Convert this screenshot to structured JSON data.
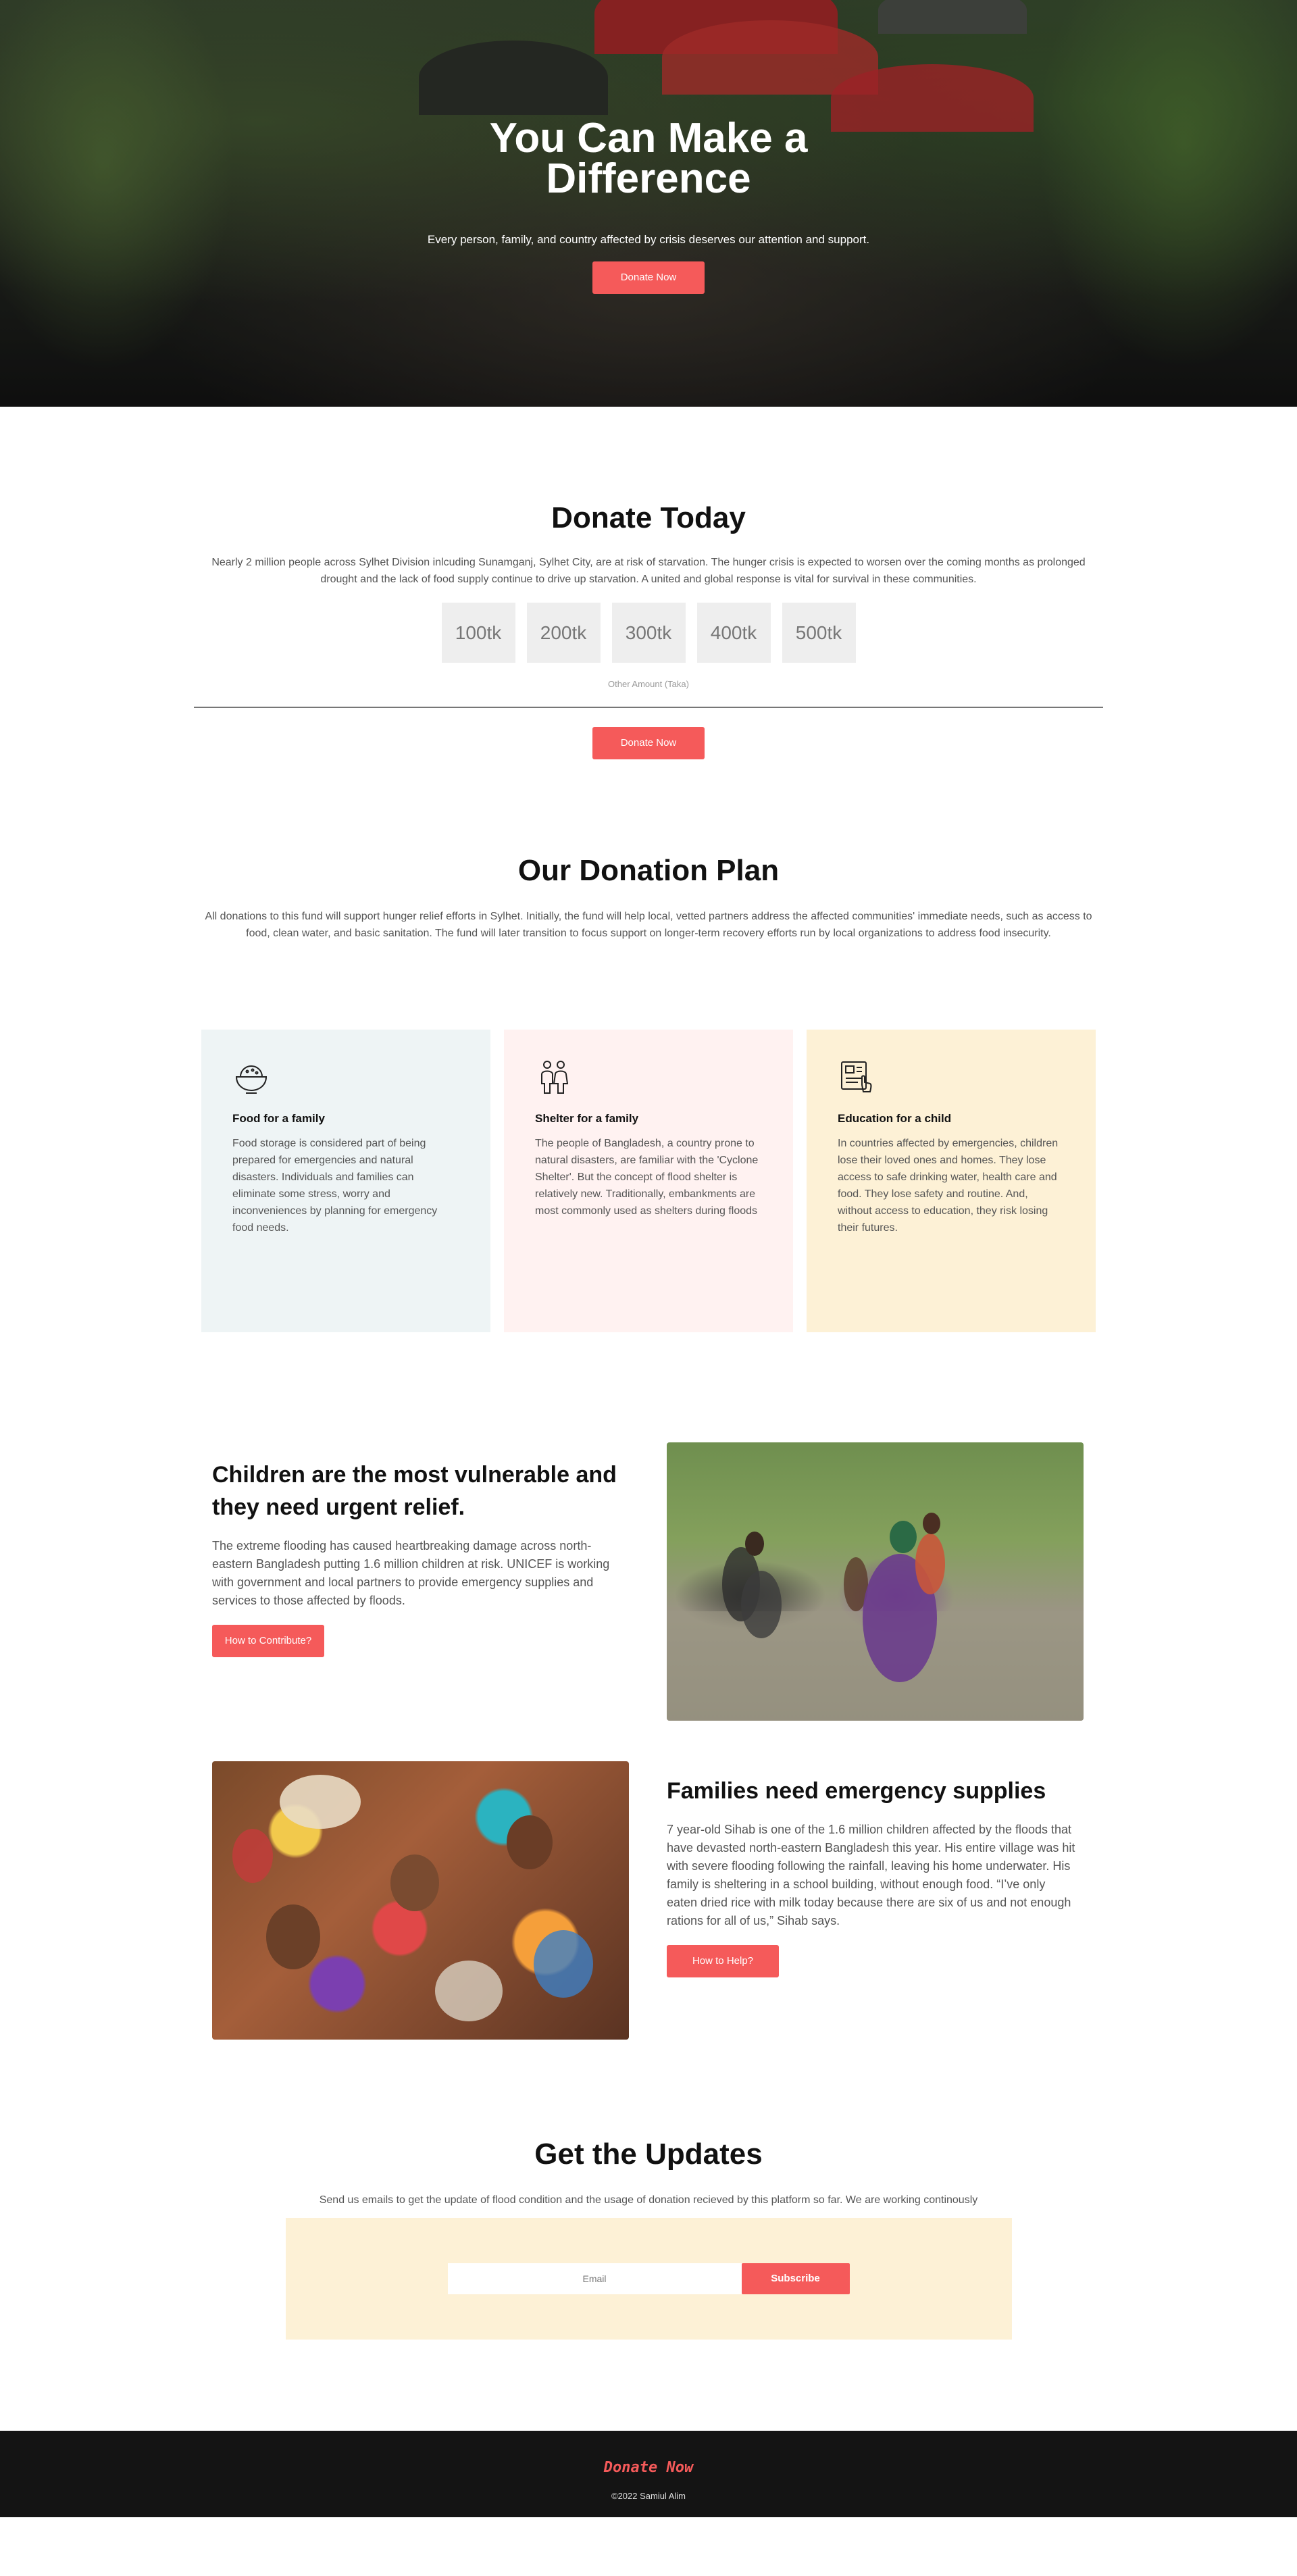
{
  "colors": {
    "accent": "#f55a5a",
    "card_food": "#eef4f5",
    "card_shelter": "#fff2f1",
    "card_education": "#fdf1d6",
    "footer_bg": "#141414"
  },
  "hero": {
    "title": "You Can Make a Difference",
    "subtitle": "Every person, family, and country affected by crisis deserves our attention and support.",
    "button": "Donate Now"
  },
  "donate_today": {
    "title": "Donate Today",
    "text": "Nearly 2 million people across Sylhet Division inlcuding Sunamganj, Sylhet City, are at risk of starvation. The hunger crisis is expected to worsen over the coming months as prolonged drought and the lack of food supply continue to drive up starvation. A united and global response is vital for survival in these communities.",
    "amounts": [
      "100tk",
      "200tk",
      "300tk",
      "400tk",
      "500tk"
    ],
    "other_amount_label": "Other Amount (Taka)",
    "button": "Donate Now"
  },
  "donation_plan": {
    "title": "Our Donation Plan",
    "text": "All donations to this fund will support hunger relief efforts in Sylhet. Initially, the fund will help local, vetted partners address the affected communities' immediate needs, such as access to food, clean water, and basic sanitation. The fund will later transition to focus support on longer-term recovery efforts run by local organizations to address food insecurity.",
    "cards": [
      {
        "icon": "food-bowl-icon",
        "title": "Food for a family",
        "text": "Food storage is considered part of being prepared for emergencies and natural disasters. Individuals and families can eliminate some stress, worry and inconveniences by planning for emergency food needs."
      },
      {
        "icon": "family-icon",
        "title": "Shelter for a family",
        "text": "The people of Bangladesh, a country prone to natural disasters, are familiar with the 'Cyclone Shelter'. But the concept of flood shelter is relatively new. Traditionally, embankments are most commonly used as shelters during floods"
      },
      {
        "icon": "education-board-icon",
        "title": "Education for a child",
        "text": "In countries affected by emergencies, children lose their loved ones and homes. They lose access to safe drinking water, health care and food. They lose safety and routine. And, without access to education, they risk losing their futures."
      }
    ]
  },
  "features": [
    {
      "title": "Children are the most vulnerable and they need urgent relief.",
      "text": "The extreme flooding has caused heartbreaking damage across north-eastern Bangladesh putting 1.6 million children at risk. UNICEF is working with government and local partners to provide emergency supplies and services to those affected by floods.",
      "button": "How to Contribute?",
      "image": "flood-family-photo"
    },
    {
      "title": "Families need emergency supplies",
      "text": "7 year-old Sihab is one of the 1.6 million children affected by the floods that have devasted north-eastern Bangladesh this year. His entire village was hit with severe flooding following the rainfall, leaving his home underwater. His family is sheltering in a school building, without enough food. “I’ve only eaten dried rice with milk today because there are six of us and not enough rations for all of us,” Sihab says.",
      "button": "How to Help?",
      "image": "relief-crowd-photo"
    }
  ],
  "updates": {
    "title": "Get the Updates",
    "text": "Send us emails to get the update of flood condition and the usage of donation recieved by this platform so far. We are working continously",
    "email_placeholder": "Email",
    "button": "Subscribe"
  },
  "footer": {
    "brand": "Donate Now",
    "copyright": "©2022 Samiul Alim"
  }
}
